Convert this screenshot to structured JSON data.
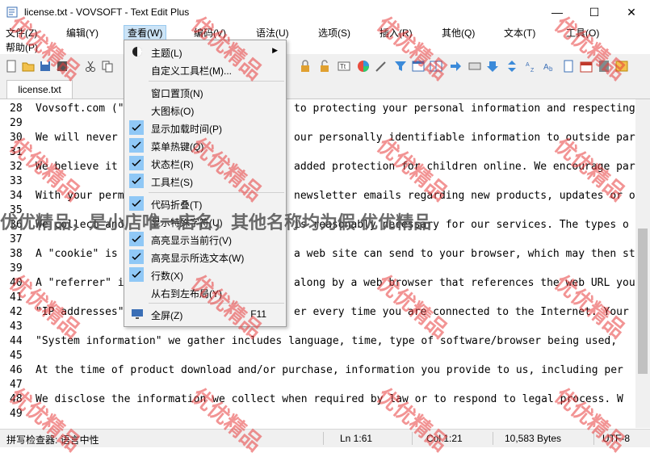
{
  "window": {
    "title": "license.txt - VOVSOFT - Text Edit Plus",
    "minimize": "—",
    "maximize": "☐",
    "close": "✕"
  },
  "menu": {
    "file": "文件(Z)",
    "edit": "编辑(Y)",
    "view": "查看(W)",
    "code": "编码(V)",
    "syntax": "语法(U)",
    "options": "选项(S)",
    "insert": "插入(R)",
    "other": "其他(Q)",
    "text": "文本(T)",
    "tools": "工具(O)",
    "help": "帮助(P)"
  },
  "tab": {
    "label": "license.txt"
  },
  "view_menu": {
    "theme": "主题(L)",
    "custom_toolbar": "自定义工具栏(M)...",
    "window_top": "窗口置顶(N)",
    "large_icons": "大图标(O)",
    "show_load_time": "显示加载时间(P)",
    "menu_hotkeys": "菜单热键(Q)",
    "status_bar": "状态栏(R)",
    "toolbar": "工具栏(S)",
    "code_folding": "代码折叠(T)",
    "show_special_chars": "显示特殊字符(U)",
    "highlight_current_line": "高亮显示当前行(V)",
    "highlight_selected_text": "高亮显示所选文本(W)",
    "line_numbers": "行数(X)",
    "rtl_layout": "从右到左布局(Y)",
    "fullscreen": "全屏(Z)",
    "fullscreen_shortcut": "F11"
  },
  "editor": {
    "line_numbers": [
      "28",
      "29",
      "30",
      "31",
      "32",
      "33",
      "34",
      "35",
      "36",
      "37",
      "38",
      "39",
      "40",
      "41",
      "42",
      "43",
      "44",
      "45",
      "46",
      "47",
      "48",
      "49"
    ],
    "lines": [
      "Vovsoft.com (\"",
      "We will never",
      "We believe it",
      "With your perm",
      "We collect and",
      "A \"cookie\" is",
      "A \"referrer\" i",
      "\"IP addresses\"",
      "\"System information\" we gather includes language, time, type of software/browser being used,",
      "At the time of product download and/or purchase, information you provide to us, including per",
      "We disclose the information we collect when required by law or to respond to legal process. W"
    ],
    "line_tails": [
      "to protecting your personal information and respecting y",
      "our personally identifiable information to outside part",
      "added protection for children online. We encourage pare",
      "newsletter emails regarding new products, updates or ot",
      "is reasonably necessary for our services. The types o",
      "a web site can send to your browser, which may then sto",
      "along by a web browser that references the web URL you",
      "er every time you are connected to the Internet. Your I"
    ]
  },
  "status": {
    "spellcheck": "拼写检查器: 语言中性",
    "ln": "Ln 1:61",
    "col": "Col 1:21",
    "bytes": "10,583 Bytes",
    "encoding": "UTF-8"
  },
  "watermark": {
    "text": "优优精品",
    "band": "优优精品，是小店唯一店名，其他名称均为假  优优精品"
  },
  "colors": {
    "menu_highlight": "#cce4f7",
    "check_bg": "#90c8f6",
    "watermark": "#e83c3c"
  }
}
